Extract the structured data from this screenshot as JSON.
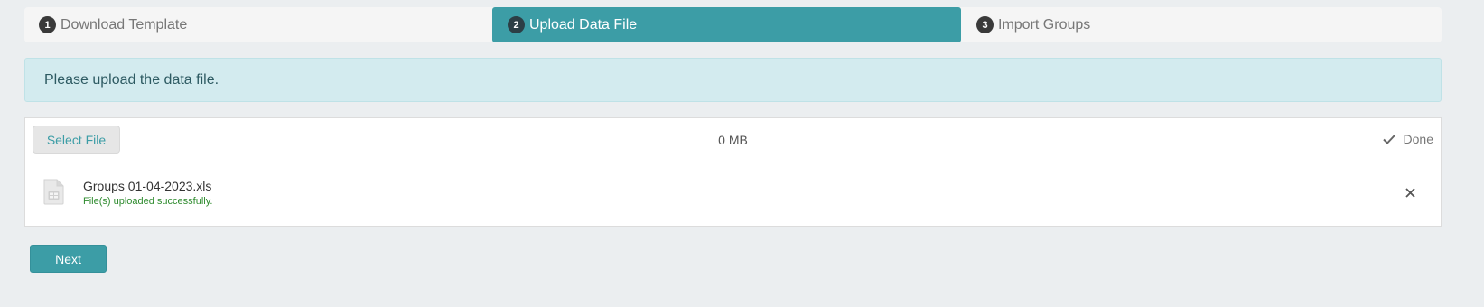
{
  "wizard": {
    "steps": [
      {
        "number": "1",
        "label": "Download Template",
        "active": false
      },
      {
        "number": "2",
        "label": "Upload Data File",
        "active": true
      },
      {
        "number": "3",
        "label": "Import Groups",
        "active": false
      }
    ]
  },
  "alert": {
    "message": "Please upload the data file."
  },
  "upload": {
    "select_label": "Select File",
    "size": "0 MB",
    "done_label": "Done",
    "files": [
      {
        "name": "Groups 01-04-2023.xls",
        "status": "File(s) uploaded successfully.",
        "icon": "spreadsheet-file-icon"
      }
    ]
  },
  "actions": {
    "next_label": "Next"
  },
  "colors": {
    "accent": "#3c9da6",
    "alert_bg": "#d3ebef",
    "success_text": "#2e8b2e",
    "page_bg": "#ebeef0"
  }
}
